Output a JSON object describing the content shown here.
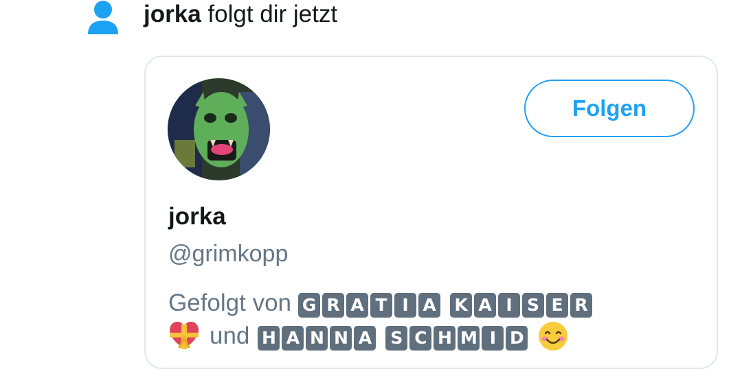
{
  "notification": {
    "icon": "person-icon",
    "user": "jorka",
    "action": " folgt dir jetzt"
  },
  "card": {
    "name": "jorka",
    "handle": "@grimkopp",
    "follow_label": "Folgen",
    "followed_prefix": "Gefolgt von",
    "followed_by_1": "GRATIA KAISER",
    "followed_by_1_words": [
      [
        "G",
        "R",
        "A",
        "T",
        "I",
        "A"
      ],
      [
        "K",
        "A",
        "I",
        "S",
        "E",
        "R"
      ]
    ],
    "heart_emoji": "heart-with-ribbon-icon",
    "conjunction": "und",
    "followed_by_2": "HANNA SCHMID",
    "followed_by_2_words": [
      [
        "H",
        "A",
        "N",
        "N",
        "A"
      ],
      [
        "S",
        "C",
        "H",
        "M",
        "I",
        "D"
      ]
    ],
    "smile_emoji": "smiling-face-icon"
  },
  "colors": {
    "accent": "#1da1f2",
    "secondary_text": "#657786",
    "letter_box": "#5f6f7e"
  }
}
